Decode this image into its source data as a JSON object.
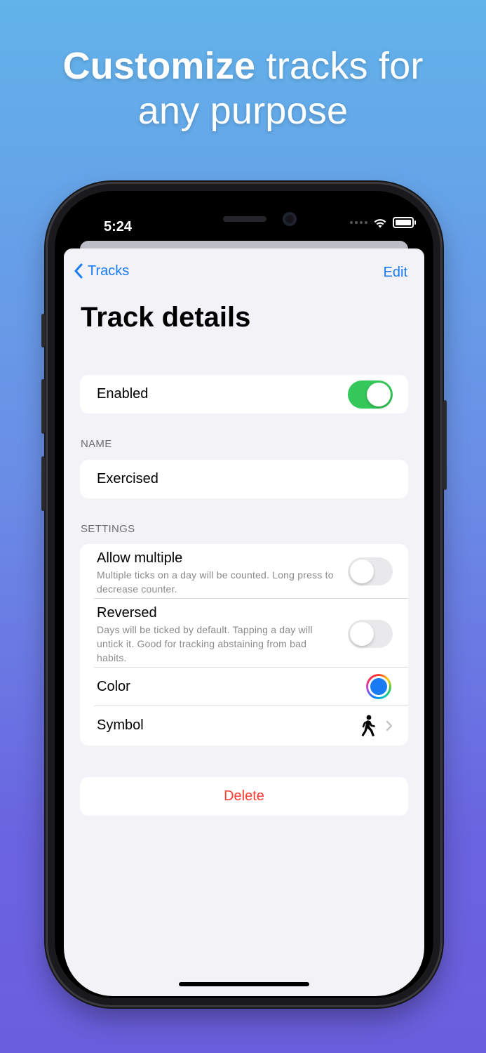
{
  "headline": {
    "bold": "Customize",
    "rest": " tracks for",
    "line2": "any purpose"
  },
  "status": {
    "time": "5:24"
  },
  "nav": {
    "back_label": "Tracks",
    "edit_label": "Edit"
  },
  "page": {
    "title": "Track details"
  },
  "enabled": {
    "label": "Enabled",
    "state": "on"
  },
  "name_section": {
    "header": "NAME",
    "value": "Exercised"
  },
  "settings": {
    "header": "SETTINGS",
    "allow_multiple": {
      "label": "Allow multiple",
      "description": "Multiple ticks on a day will be counted. Long press to decrease counter.",
      "state": "off"
    },
    "reversed": {
      "label": "Reversed",
      "description": "Days will be ticked by default. Tapping a day will untick it. Good for tracking abstaining from bad habits.",
      "state": "off"
    },
    "color": {
      "label": "Color",
      "value": "#1a7cf2"
    },
    "symbol": {
      "label": "Symbol",
      "icon": "figure-walk-icon"
    }
  },
  "delete_label": "Delete",
  "colors": {
    "accent": "#1a7cf2",
    "toggle_on": "#34c759",
    "destructive": "#ff3b30"
  }
}
